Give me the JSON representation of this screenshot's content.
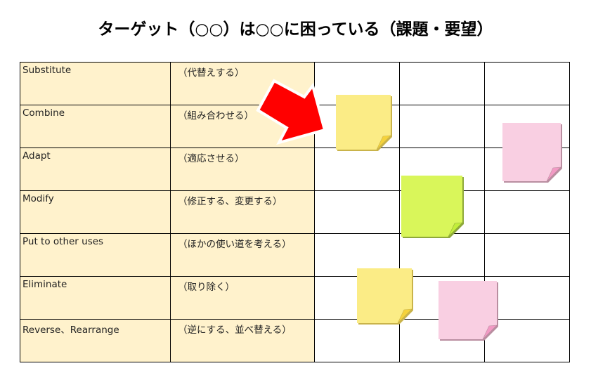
{
  "title": "ターゲット（○○）は○○に困っている（課題・要望）",
  "rows": [
    {
      "en": "Substitute",
      "jp": "（代替えする）"
    },
    {
      "en": "Combine",
      "jp": "（組み合わせる）"
    },
    {
      "en": "Adapt",
      "jp": "（適応させる）"
    },
    {
      "en": "Modify",
      "jp": "（修正する、変更する）"
    },
    {
      "en": "Put to other uses",
      "jp": "（ほかの使い道を考える）"
    },
    {
      "en": "Eliminate",
      "jp": "（取り除く）"
    },
    {
      "en": "Reverse、Rearrange",
      "jp": "（逆にする、並べ替える）"
    }
  ],
  "sticky_notes": [
    {
      "color": "yellow",
      "fill": "#fbec86",
      "fold": "#f5d23c",
      "edge": "#c9b34a"
    },
    {
      "color": "pink",
      "fill": "#f9cfe2",
      "fold": "#f29ac4",
      "edge": "#b98ea0"
    },
    {
      "color": "green",
      "fill": "#d9f65a",
      "fold": "#c2ee3a",
      "edge": "#8ea83a"
    },
    {
      "color": "yellow",
      "fill": "#fbec86",
      "fold": "#f5d23c",
      "edge": "#c9b34a"
    },
    {
      "color": "pink",
      "fill": "#f9cfe2",
      "fold": "#f29ac4",
      "edge": "#b98ea0"
    }
  ],
  "arrow": {
    "icon": "arrow-pointer-icon",
    "color": "#ff0000",
    "outline": "#ffffff"
  }
}
